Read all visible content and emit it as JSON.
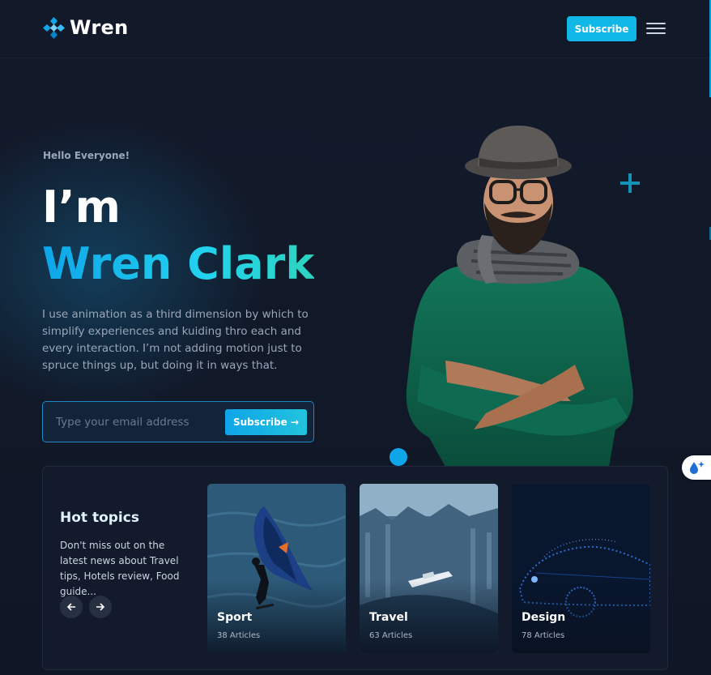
{
  "header": {
    "logo_text": "Wren",
    "subscribe_label": "Subscribe"
  },
  "hero": {
    "greeting": "Hello Everyone!",
    "line1": "I’m",
    "name": "Wren Clark",
    "description": "I use animation as a third dimension by which to simplify experiences and kuiding thro each and every interaction. I’m not adding motion just to spruce things up, but doing it in ways that.",
    "email_placeholder": "Type your email address",
    "email_button_label": "Subscribe →"
  },
  "topics": {
    "title": "Hot topics",
    "text": "Don't miss out on the latest news about Travel tips, Hotels review, Food guide...",
    "cards": [
      {
        "title": "Sport",
        "count": "38 Articles"
      },
      {
        "title": "Travel",
        "count": "63 Articles"
      },
      {
        "title": "Design",
        "count": "78 Articles"
      }
    ]
  },
  "colors": {
    "accent": "#0fb8e6",
    "background": "#111827",
    "panel": "#121a2b"
  },
  "icons": {
    "logo": "wren-logo-icon",
    "menu": "hamburger-menu-icon",
    "prev": "arrow-left-icon",
    "next": "arrow-right-icon",
    "badge": "droplet-sparkle-icon"
  }
}
